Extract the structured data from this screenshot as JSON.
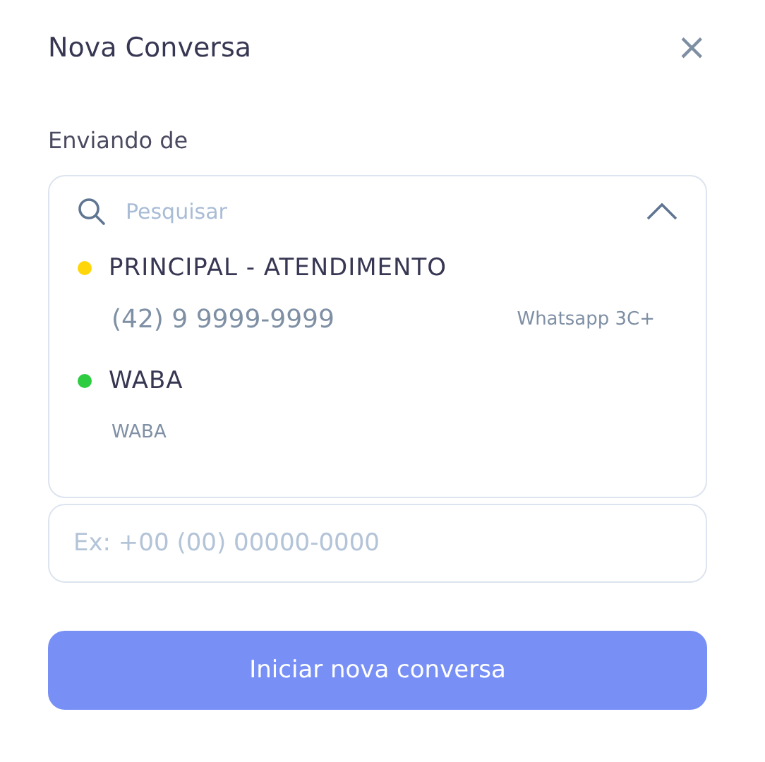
{
  "dialog": {
    "title": "Nova Conversa",
    "close": "×"
  },
  "sender": {
    "label": "Enviando de",
    "search": {
      "placeholder": "Pesquisar"
    },
    "expanded": true,
    "options": [
      {
        "name": "PRINCIPAL - ATENDIMENTO",
        "color": "#ffd60a",
        "number": "(42) 9 9999-9999",
        "channel": "Whatsapp 3C+"
      },
      {
        "name": "WABA",
        "color": "#2ecc40",
        "number": "WABA"
      }
    ]
  },
  "phone": {
    "placeholder": "Ex: +00 (00) 00000-0000"
  },
  "submit": {
    "label": "Iniciar nova conversa",
    "disabled": true
  }
}
